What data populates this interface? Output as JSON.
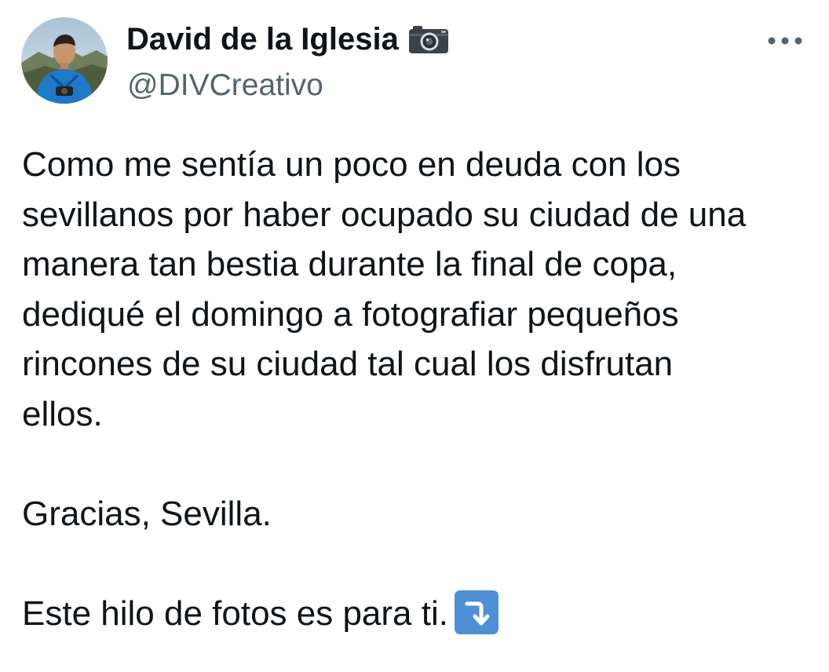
{
  "author": {
    "display_name": "David de la Iglesia",
    "handle": "@DIVCreativo",
    "name_icon": "camera-icon",
    "avatar_icon": "avatar-photo"
  },
  "menu": {
    "icon": "more-options-icon"
  },
  "tweet": {
    "lines": [
      "Como me sentía un poco en deuda con los",
      "sevillanos por haber ocupado su ciudad de una",
      "manera tan bestia durante la final de copa,",
      "dediqué el domingo a fotografiar pequeños",
      "rincones de su ciudad tal cual los disfrutan",
      "ellos."
    ],
    "thanks": "Gracias, Sevilla.",
    "closing": "Este hilo de fotos es para ti.",
    "closing_icon": "arrow-down-turn-icon"
  },
  "colors": {
    "text": "#0f1419",
    "secondary": "#536471",
    "emoji_blue": "#4f8fd6"
  }
}
